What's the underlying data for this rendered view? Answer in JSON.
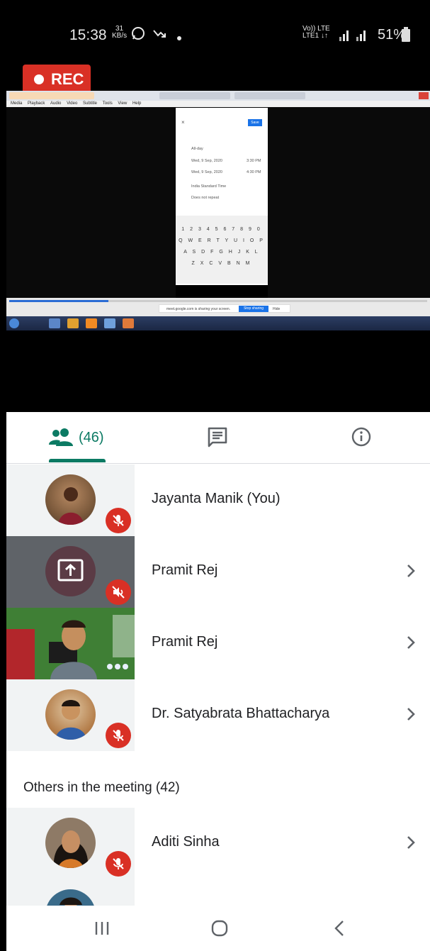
{
  "status_bar": {
    "time": "15:38",
    "speed_value": "31",
    "speed_unit": "KB/s",
    "network_top": "Vo)) LTE",
    "network_bottom": "LTE1 ↓↑",
    "battery": "51%"
  },
  "recording": {
    "label": "REC"
  },
  "tabs": {
    "people_count": "(46)",
    "people_icon": "people-icon",
    "chat_icon": "chat-icon",
    "info_icon": "info-icon",
    "accent_color": "#0b7a63"
  },
  "participants": [
    {
      "name": "Jayanta Manik (You)",
      "muted": true
    },
    {
      "name": "Pramit Rej",
      "muted": true,
      "presenting": true
    },
    {
      "name": "Pramit Rej",
      "muted": false
    },
    {
      "name": "Dr. Satyabrata Bhattacharya",
      "muted": true
    }
  ],
  "others_section": {
    "title": "Others in the meeting (42)",
    "participants": [
      {
        "name": "Aditi Sinha",
        "muted": true
      }
    ]
  },
  "shared_screen": {
    "menu_items": [
      "Media",
      "Playback",
      "Audio",
      "Video",
      "Subtitle",
      "Tools",
      "View",
      "Help"
    ],
    "phone": {
      "save_label": "Save",
      "all_day": "All-day",
      "start_date": "Wed, 9 Sep, 2020",
      "start_time": "3:30 PM",
      "end_date": "Wed, 9 Sep, 2020",
      "end_time": "4:30 PM",
      "timezone": "India Standard Time",
      "repeat": "Does not repeat",
      "kb_row1": "1 2 3 4 5 6 7 8 9 0",
      "kb_row2": "Q W E R T Y U I O P",
      "kb_row3": "A S D F G H J K L",
      "kb_row4": "Z X C V B N M"
    },
    "share_notice": "meet.google.com is sharing your screen.",
    "stop_sharing": "Stop sharing",
    "hide": "Hide"
  },
  "colors": {
    "mute_red": "#d93025",
    "rec_red": "#d93025"
  }
}
